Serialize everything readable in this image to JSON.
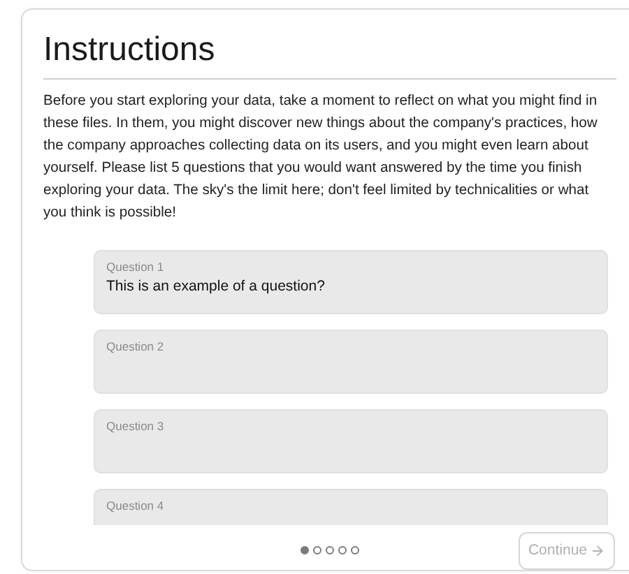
{
  "title": "Instructions",
  "intro": "Before you start exploring your data, take a moment to reflect on what you might find in these files. In them, you might discover new things about the company's practices, how the company approaches collecting data on its users, and you might even learn about yourself. Please list 5 questions that you would want answered by the time you finish exploring your data. The sky's the limit here; don't feel limited by technicalities or what you think is possible!",
  "questions": [
    {
      "label": "Question 1",
      "value": "This is an example of a question?"
    },
    {
      "label": "Question 2"
    },
    {
      "label": "Question 3"
    },
    {
      "label": "Question 4"
    }
  ],
  "pager": [
    {
      "selected": true
    },
    {
      "selected": false
    },
    {
      "selected": false
    },
    {
      "selected": false
    },
    {
      "selected": false
    }
  ],
  "continue_button": {
    "label": "Continue",
    "disabled": true
  }
}
